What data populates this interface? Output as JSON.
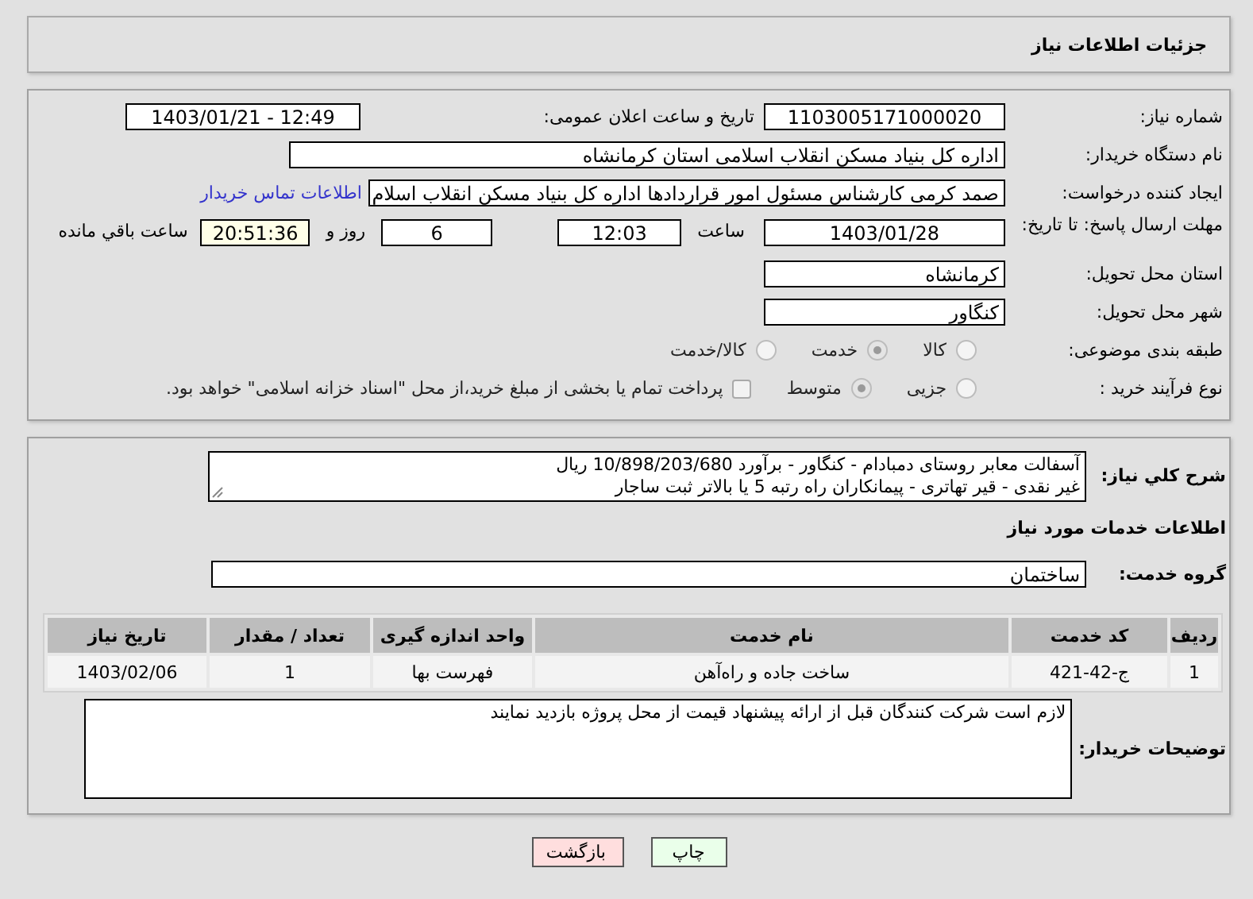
{
  "header": {
    "title": "جزئیات اطلاعات نیاز"
  },
  "details": {
    "need_number": {
      "label": "شماره نیاز:",
      "value": "1103005171000020"
    },
    "announce": {
      "label": "تاریخ و ساعت اعلان عمومی:",
      "value": "1403/01/21 - 12:49"
    },
    "buyer": {
      "label": "نام دستگاه خریدار:",
      "value": "اداره کل بنیاد مسکن انقلاب اسلامی استان کرمانشاه"
    },
    "creator": {
      "label": "ایجاد کننده درخواست:",
      "value": "صمد کرمی کارشناس مسئول امور قراردادها اداره کل بنیاد مسکن انقلاب اسلام",
      "link": "اطلاعات تماس خریدار"
    },
    "deadline": {
      "label": "مهلت ارسال پاسخ: تا تاریخ:",
      "date": "1403/01/28",
      "time_label": "ساعت",
      "time": "12:03",
      "days": "6",
      "days_label": "روز و",
      "remaining": "20:51:36",
      "remaining_label": "ساعت باقي مانده"
    },
    "province": {
      "label": "استان محل تحویل:",
      "value": "کرمانشاه"
    },
    "city": {
      "label": "شهر محل تحویل:",
      "value": "کنگاور"
    },
    "classification": {
      "label": "طبقه بندی موضوعی:",
      "options": [
        {
          "label": "کالا",
          "selected": false
        },
        {
          "label": "خدمت",
          "selected": true
        },
        {
          "label": "کالا/خدمت",
          "selected": false
        }
      ]
    },
    "process": {
      "label": "نوع فرآیند خرید :",
      "options": [
        {
          "label": "جزیی",
          "selected": false
        },
        {
          "label": "متوسط",
          "selected": true
        }
      ],
      "treasury": {
        "checked": false,
        "label": "پرداخت تمام یا بخشی از مبلغ خرید،از محل \"اسناد خزانه اسلامی\" خواهد بود."
      }
    }
  },
  "need": {
    "label": "شرح کلي نیاز:",
    "lines": [
      "آسفالت معابر روستای دمبادام - کنگاور - برآورد 10/898/203/680 ریال",
      "غیر نقدی - قیر تهاتری - پیمانکاران راه رتبه 5 یا بالاتر ثبت ساجار"
    ]
  },
  "services": {
    "heading": "اطلاعات خدمات مورد نیاز",
    "group_label": "گروه خدمت:",
    "group": "ساختمان",
    "table": {
      "columns": [
        "ردیف",
        "کد خدمت",
        "نام خدمت",
        "واحد اندازه گیری",
        "تعداد / مقدار",
        "تاریخ نیاز"
      ],
      "rows": [
        [
          "1",
          "ج-42-421",
          "ساخت جاده و راه‌آهن",
          "فهرست بها",
          "1",
          "1403/02/06"
        ]
      ]
    }
  },
  "buyer_notes": {
    "label": "توضیحات خریدار:",
    "value": "لازم است شرکت کنندگان قبل از ارائه پیشنهاد قیمت از محل پروژه بازدید نمایند"
  },
  "buttons": [
    {
      "label": "چاپ",
      "kind": "print"
    },
    {
      "label": "بازگشت",
      "kind": "back"
    }
  ]
}
